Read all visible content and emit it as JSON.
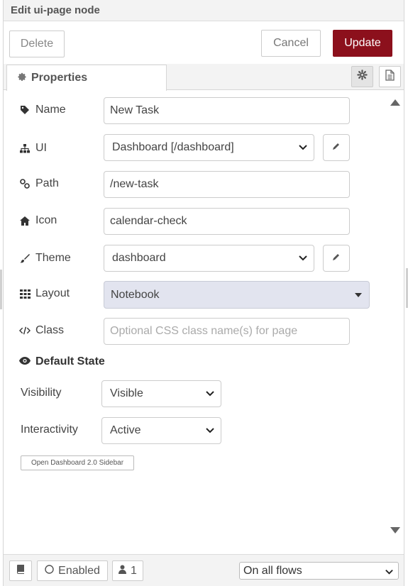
{
  "title": "Edit ui-page node",
  "actions": {
    "delete_label": "Delete",
    "cancel_label": "Cancel",
    "update_label": "Update"
  },
  "tabs": {
    "properties_label": "Properties"
  },
  "fields": {
    "name": {
      "label": "Name",
      "value": "New Task"
    },
    "ui": {
      "label": "UI",
      "value": "Dashboard [/dashboard]"
    },
    "path": {
      "label": "Path",
      "value": "/new-task"
    },
    "icon": {
      "label": "Icon",
      "value": "calendar-check"
    },
    "theme": {
      "label": "Theme",
      "value": "dashboard"
    },
    "layout": {
      "label": "Layout",
      "value": "Notebook"
    },
    "class": {
      "label": "Class",
      "placeholder": "Optional CSS class name(s) for page"
    }
  },
  "default_state": {
    "heading": "Default State",
    "visibility": {
      "label": "Visibility",
      "value": "Visible"
    },
    "interactivity": {
      "label": "Interactivity",
      "value": "Active"
    }
  },
  "sidebar_button_label": "Open Dashboard 2.0 Sidebar",
  "footer": {
    "enabled_label": "Enabled",
    "users_count": "1",
    "flows_select": "On all flows"
  },
  "colors": {
    "update_button": "#8c101c",
    "layout_select_bg": "#e2e4ef",
    "panel_header_bg": "#f3f3f3"
  },
  "icons": {
    "name": "tag-icon",
    "ui": "sitemap-icon",
    "path": "link-icon",
    "icon": "home-icon",
    "theme": "paintbrush-icon",
    "layout": "grid-icon",
    "class": "code-icon",
    "default_state": "eye-icon"
  }
}
